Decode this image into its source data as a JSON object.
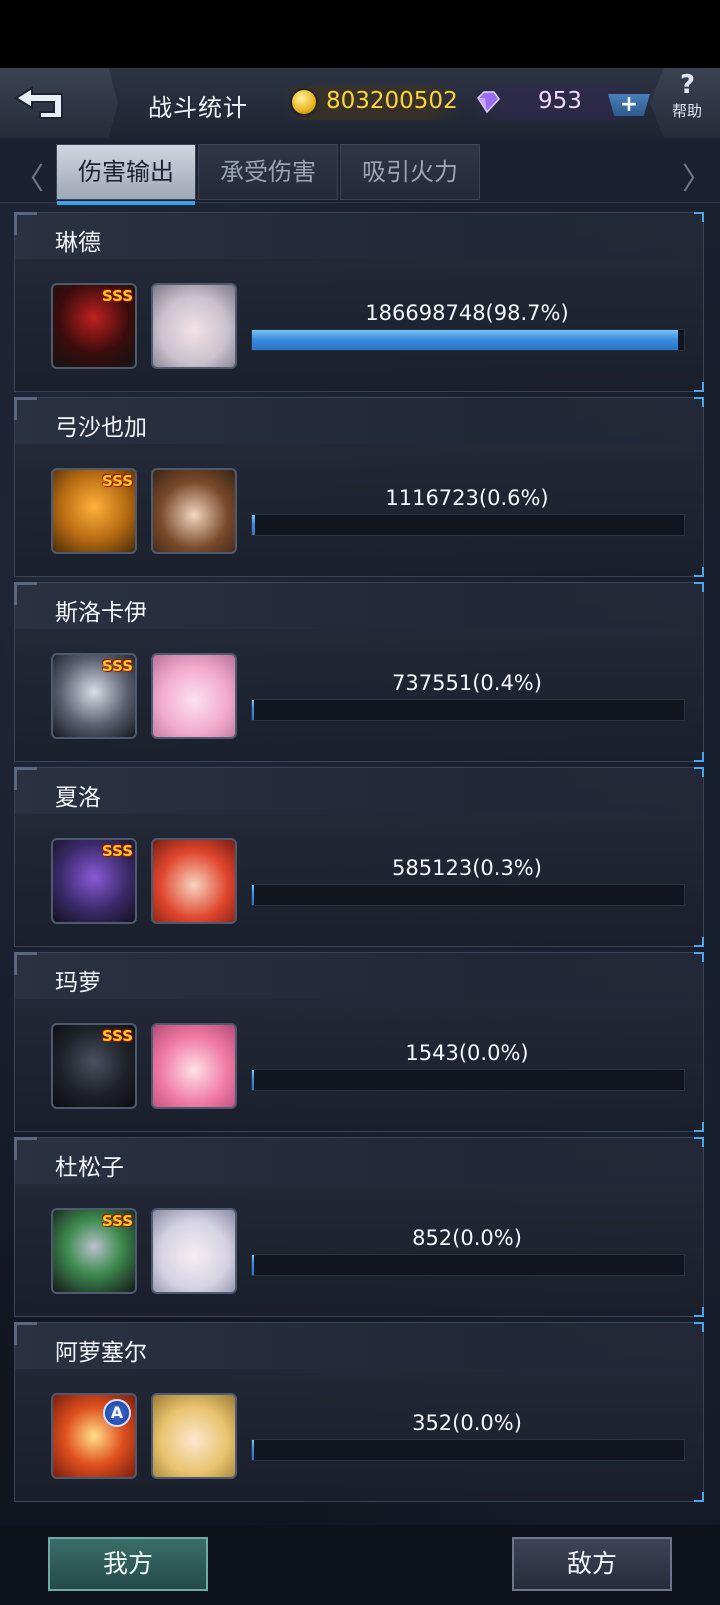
{
  "header": {
    "title": "战斗统计",
    "gold": "803200502",
    "gems": "953",
    "plus_label": "+",
    "help_symbol": "?",
    "help_label": "帮助"
  },
  "tabs": [
    {
      "label": "伤害输出",
      "active": true
    },
    {
      "label": "承受伤害",
      "active": false
    },
    {
      "label": "吸引火力",
      "active": false
    }
  ],
  "nav": {
    "prev": "〈",
    "next": "〉"
  },
  "rows": [
    {
      "name": "琳德",
      "mech_rank": "SSS",
      "damage": "186698748(98.7%)",
      "percent": 98.7
    },
    {
      "name": "弓沙也加",
      "mech_rank": "SSS",
      "damage": "1116723(0.6%)",
      "percent": 0.6
    },
    {
      "name": "斯洛卡伊",
      "mech_rank": "SSS",
      "damage": "737551(0.4%)",
      "percent": 0.4
    },
    {
      "name": "夏洛",
      "mech_rank": "SSS",
      "damage": "585123(0.3%)",
      "percent": 0.3
    },
    {
      "name": "玛萝",
      "mech_rank": "SSS",
      "damage": "1543(0.0%)",
      "percent": 0.0
    },
    {
      "name": "杜松子",
      "mech_rank": "SSS",
      "damage": "852(0.0%)",
      "percent": 0.0
    },
    {
      "name": "阿萝塞尔",
      "mech_rank": "A",
      "damage": "352(0.0%)",
      "percent": 0.0
    }
  ],
  "footer": {
    "my_side": "我方",
    "enemy_side": "敌方"
  },
  "colors": {
    "bar": "#3b8ee0",
    "gold": "#ffd23a",
    "accent": "#4da6e8"
  }
}
